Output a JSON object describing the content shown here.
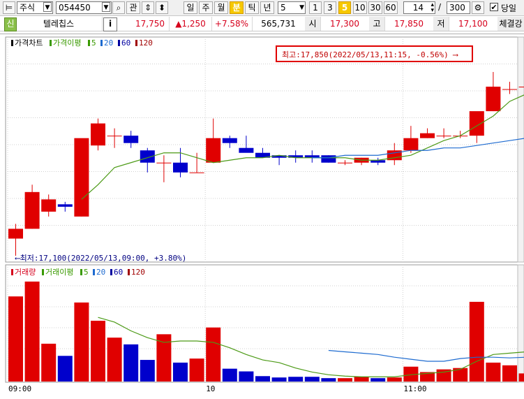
{
  "toolbar": {
    "market": "주식",
    "code": "054450",
    "btn_gwan": "관",
    "periods": [
      "일",
      "주",
      "월",
      "분",
      "틱",
      "년"
    ],
    "active_period": "분",
    "interval": "5",
    "quick_intervals": [
      "1",
      "3",
      "5",
      "10",
      "30",
      "60"
    ],
    "active_interval": "5",
    "count": "14",
    "slash": "/",
    "max": "300",
    "today_label": "당일",
    "today_checked": true
  },
  "info": {
    "badge": "신",
    "name": "텔레칩스",
    "info_btn": "i",
    "price": "17,750",
    "change": "▲1,250",
    "change_pct": "+7.58%",
    "volume": "565,731",
    "open_label": "시",
    "open": "17,300",
    "high_label": "고",
    "high": "17,850",
    "low_label": "저",
    "low": "17,100",
    "exec_label": "체결강"
  },
  "price_panel": {
    "legend": [
      {
        "label": "가격차트",
        "color": "#000000"
      },
      {
        "label": "가격이평",
        "color": "#3a9a00"
      },
      {
        "label": "5",
        "color": "#3a9a00"
      },
      {
        "label": "20",
        "color": "#1e6bd0"
      },
      {
        "label": "60",
        "color": "#0000a0"
      },
      {
        "label": "120",
        "color": "#a00000"
      }
    ],
    "max_note": "최고:17,850(2022/05/13,11:15, -0.56%)",
    "min_note": "최저:17,100(2022/05/13,09:00, +3.80%)"
  },
  "volume_panel": {
    "legend": [
      {
        "label": "거래량",
        "color": "#d6001c"
      },
      {
        "label": "거래이평",
        "color": "#3a9a00"
      },
      {
        "label": "5",
        "color": "#3a9a00"
      },
      {
        "label": "20",
        "color": "#1e6bd0"
      },
      {
        "label": "60",
        "color": "#0000a0"
      },
      {
        "label": "120",
        "color": "#a00000"
      }
    ]
  },
  "colors": {
    "up": "#e00000",
    "down": "#0000cc",
    "ma5": "#4c9a16",
    "ma20": "#1e6bd0"
  },
  "chart_data": {
    "type": "candlestick",
    "x_labels": [
      "09:00",
      "10",
      "11:00"
    ],
    "x_label_index": [
      0,
      12,
      24
    ],
    "ohlc": [
      [
        17170,
        17230,
        17100,
        17210
      ],
      [
        17210,
        17390,
        17210,
        17360
      ],
      [
        17280,
        17350,
        17260,
        17330
      ],
      [
        17310,
        17320,
        17280,
        17300
      ],
      [
        17260,
        17500,
        17260,
        17580
      ],
      [
        17550,
        17660,
        17530,
        17640
      ],
      [
        17590,
        17620,
        17540,
        17590
      ],
      [
        17590,
        17610,
        17540,
        17560
      ],
      [
        17530,
        17540,
        17440,
        17480
      ],
      [
        17480,
        17510,
        17400,
        17480
      ],
      [
        17480,
        17540,
        17420,
        17440
      ],
      [
        17440,
        17520,
        17440,
        17440
      ],
      [
        17480,
        17660,
        17480,
        17580
      ],
      [
        17580,
        17590,
        17540,
        17560
      ],
      [
        17540,
        17590,
        17530,
        17520
      ],
      [
        17520,
        17540,
        17510,
        17500
      ],
      [
        17510,
        17510,
        17470,
        17500
      ],
      [
        17510,
        17530,
        17480,
        17500
      ],
      [
        17510,
        17530,
        17480,
        17500
      ],
      [
        17510,
        17510,
        17480,
        17480
      ],
      [
        17480,
        17490,
        17470,
        17480
      ],
      [
        17480,
        17500,
        17470,
        17500
      ],
      [
        17490,
        17500,
        17470,
        17480
      ],
      [
        17490,
        17560,
        17470,
        17530
      ],
      [
        17530,
        17630,
        17520,
        17580
      ],
      [
        17580,
        17620,
        17580,
        17600
      ],
      [
        17590,
        17620,
        17580,
        17590
      ],
      [
        17590,
        17610,
        17580,
        17590
      ],
      [
        17590,
        17680,
        17560,
        17690
      ],
      [
        17690,
        17850,
        17690,
        17790
      ],
      [
        17780,
        17810,
        17760,
        17780
      ],
      [
        17790,
        17810,
        17750,
        17790
      ]
    ],
    "ma5": [
      null,
      null,
      null,
      null,
      17330,
      17390,
      17460,
      17480,
      17500,
      17520,
      17520,
      17500,
      17480,
      17490,
      17500,
      17500,
      17510,
      17500,
      17500,
      17500,
      17500,
      17490,
      17490,
      17500,
      17510,
      17540,
      17570,
      17590,
      17630,
      17670,
      17730,
      17760
    ],
    "ma20": [
      null,
      null,
      null,
      null,
      null,
      null,
      null,
      null,
      null,
      null,
      null,
      null,
      null,
      null,
      null,
      null,
      null,
      null,
      17500,
      17500,
      17510,
      17510,
      17510,
      17520,
      17530,
      17530,
      17540,
      17540,
      17550,
      17560,
      17570,
      17580
    ],
    "volume": [
      126,
      148,
      56,
      38,
      117,
      90,
      65,
      55,
      32,
      70,
      28,
      34,
      80,
      19,
      15,
      8,
      6,
      7,
      7,
      5,
      5,
      7,
      5,
      6,
      22,
      14,
      18,
      20,
      118,
      28,
      24,
      12
    ],
    "vol_ma5": [
      null,
      null,
      null,
      null,
      null,
      null,
      null,
      null,
      null,
      null,
      null,
      null,
      null,
      null,
      null,
      null,
      null,
      null,
      null,
      null,
      null,
      null,
      null,
      null,
      null,
      null,
      null,
      null,
      null,
      40,
      42,
      44
    ]
  }
}
